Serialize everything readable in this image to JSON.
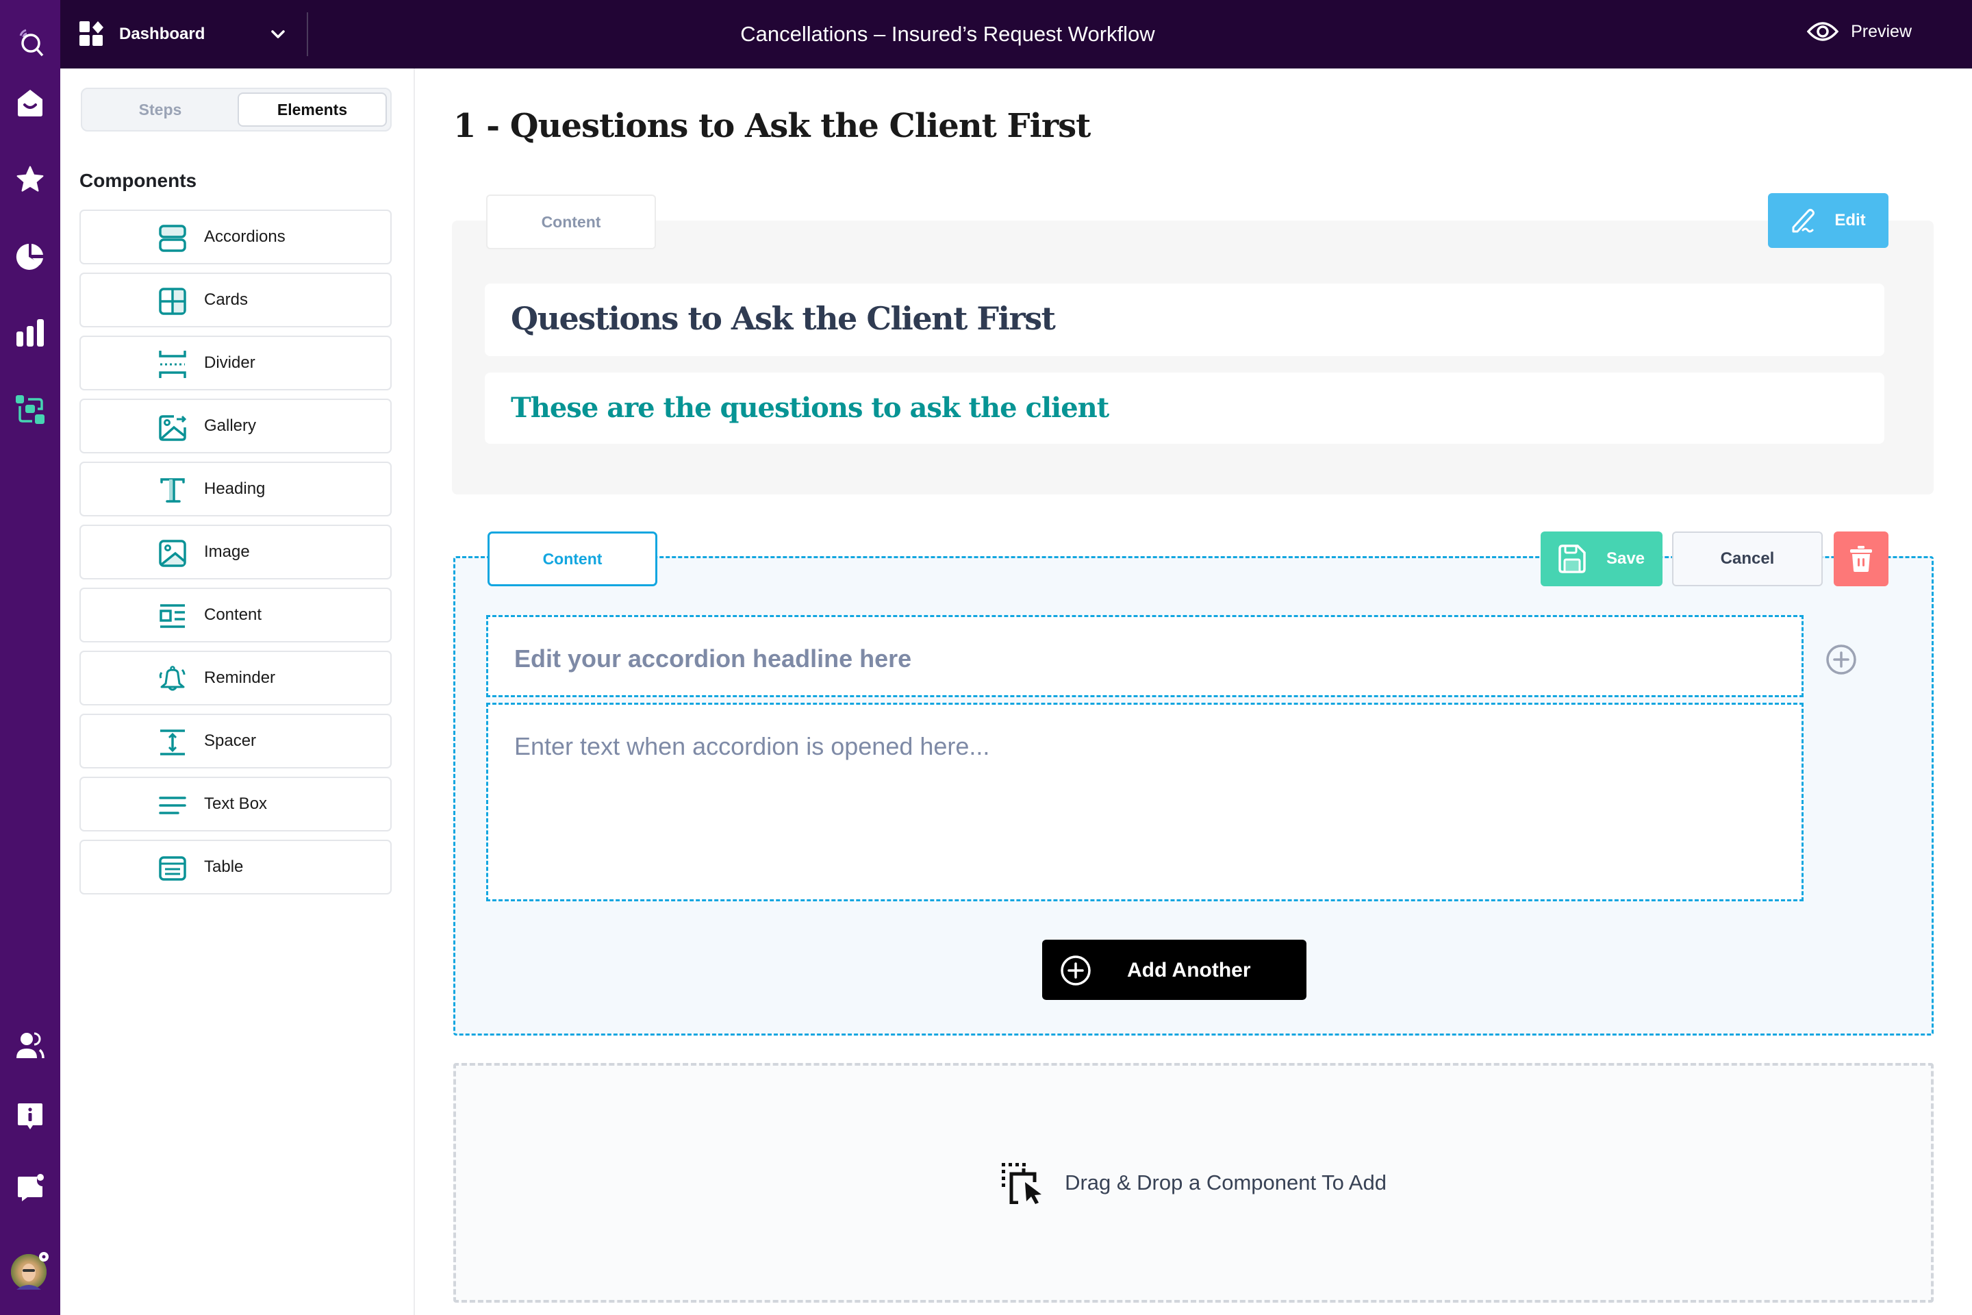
{
  "rail": {
    "items": [
      {
        "icon": "search-signal-icon"
      },
      {
        "icon": "home-icon"
      },
      {
        "icon": "star-icon"
      },
      {
        "icon": "pie-chart-icon"
      },
      {
        "icon": "bar-chart-icon"
      },
      {
        "icon": "workflow-icon",
        "active": true
      },
      {
        "icon": "users-icon"
      },
      {
        "icon": "info-icon"
      },
      {
        "icon": "chat-notification-icon"
      },
      {
        "icon": "avatar"
      }
    ],
    "active_color": "#46d4b2"
  },
  "topbar": {
    "dashboard_label": "Dashboard",
    "title": "Cancellations – Insured’s Request Workflow",
    "preview_label": "Preview"
  },
  "panel": {
    "tabs": [
      {
        "label": "Steps",
        "active": false
      },
      {
        "label": "Elements",
        "active": true
      }
    ],
    "components_title": "Components",
    "components": [
      {
        "label": "Accordions",
        "icon": "accordion-icon"
      },
      {
        "label": "Cards",
        "icon": "cards-icon"
      },
      {
        "label": "Divider",
        "icon": "divider-icon"
      },
      {
        "label": "Gallery",
        "icon": "gallery-icon"
      },
      {
        "label": "Heading",
        "icon": "heading-icon"
      },
      {
        "label": "Image",
        "icon": "image-icon"
      },
      {
        "label": "Content",
        "icon": "content-icon"
      },
      {
        "label": "Reminder",
        "icon": "bell-icon"
      },
      {
        "label": "Spacer",
        "icon": "spacer-icon"
      },
      {
        "label": "Text Box",
        "icon": "text-lines-icon"
      },
      {
        "label": "Table",
        "icon": "table-icon"
      }
    ]
  },
  "main": {
    "page_title": "1 - Questions to Ask the Client First",
    "block1": {
      "tab_label": "Content",
      "edit_label": "Edit",
      "heading": "Questions to Ask the Client First",
      "subheading": "These are the questions to ask the client"
    },
    "block2": {
      "tab_label": "Content",
      "save_label": "Save",
      "cancel_label": "Cancel",
      "headline_placeholder": "Edit your accordion headline here",
      "body_placeholder": "Enter text when accordion is opened here...",
      "add_another_label": "Add Another"
    },
    "dropzone_label": "Drag & Drop a Component To Add"
  },
  "colors": {
    "rail_bg": "#4a0f6b",
    "topbar_bg": "#220535",
    "teal": "#079494",
    "edit_blue": "#4bbcf0",
    "save_green": "#46d4b2",
    "delete_red": "#fd7878",
    "dashed_blue": "#12a6e0"
  }
}
